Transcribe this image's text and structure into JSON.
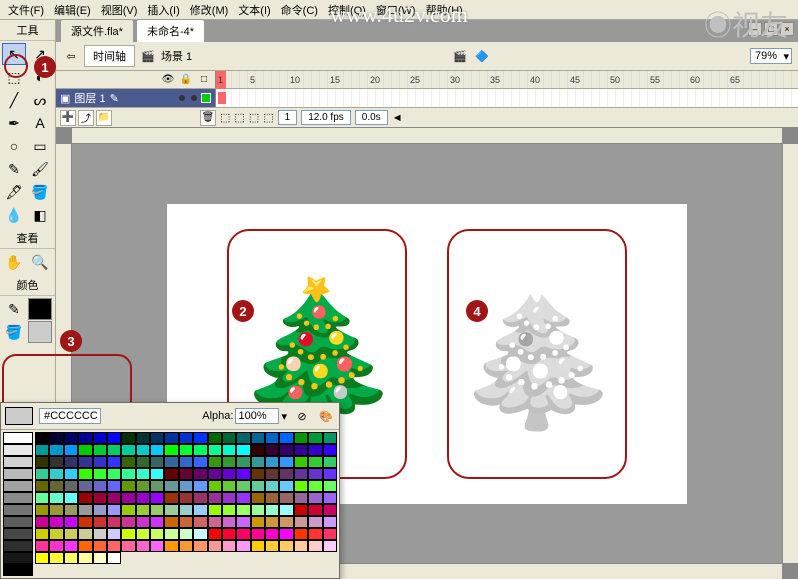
{
  "menu": {
    "file": "文件(F)",
    "edit": "编辑(E)",
    "view": "视图(V)",
    "insert": "插入(I)",
    "modify": "修改(M)",
    "text": "文本(I)",
    "commands": "命令(C)",
    "control": "控制(Q)",
    "window": "窗口(W)",
    "help": "帮助(H)"
  },
  "watermark": "www.4u2v.com",
  "tools": {
    "title": "工具",
    "view": "查看",
    "colors": "颜色"
  },
  "tabs": {
    "t1": "源文件.fla*",
    "t2": "未命名-4*"
  },
  "toolbar": {
    "timeline": "时间轴",
    "scene": "场景 1",
    "zoom": "79%"
  },
  "timeline": {
    "layer": "图层 1",
    "marks": [
      "1",
      "5",
      "10",
      "15",
      "20",
      "25",
      "30",
      "35",
      "40",
      "45",
      "50",
      "55",
      "60",
      "65"
    ],
    "frame": "1",
    "fps": "12.0 fps",
    "time": "0.0s"
  },
  "color_popup": {
    "hex": "#CCCCCC",
    "alpha_label": "Alpha:",
    "alpha_val": "100%"
  },
  "callouts": {
    "c1": "1",
    "c2": "2",
    "c3": "3",
    "c4": "4"
  }
}
